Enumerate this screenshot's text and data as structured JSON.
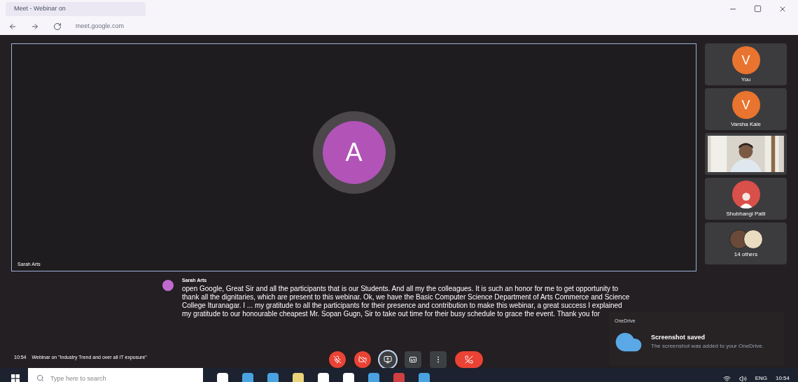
{
  "browser": {
    "tab_title": "Meet - Webinar on",
    "url": "meet.google.com"
  },
  "main_tile": {
    "avatar_letter": "A",
    "name": "Sarah Arts"
  },
  "participants": [
    {
      "kind": "avatar",
      "letter": "V",
      "color": "#e8742f",
      "name": "You"
    },
    {
      "kind": "avatar",
      "letter": "V",
      "color": "#e8742f",
      "name": "Varsha Kale"
    },
    {
      "kind": "video"
    },
    {
      "name": "Shubhangi Patil"
    },
    {
      "kind": "group",
      "name": "14 others"
    }
  ],
  "caption": {
    "speaker": "Sarah Arts",
    "text": "open Google, Great Sir and all the participants that is our Students. And all my the colleagues. It is such an honor for me to get opportunity to thank all the dignitaries, which are present to this webinar. Ok, we have the Basic Computer Science Department of Arts Commerce and Science College Ituranagar. I ... my gratitude to all the participants for their presence and contribution to make this webinar, a great success I explained my gratitude to our honourable cheapest Mr. Sopan Gugn, Sir to take out time for their busy schedule to grace the event. Thank you for"
  },
  "meeting": {
    "time": "10:54",
    "title": "Webinar on \"Industry Trend and over all IT exposure\""
  },
  "controls": [
    {
      "kind": "mic",
      "muted": true
    },
    {
      "kind": "camera",
      "muted": true
    },
    {
      "kind": "present"
    },
    {
      "kind": "captions"
    },
    {
      "kind": "more"
    },
    {
      "kind": "leave"
    }
  ],
  "notification": {
    "app": "OneDrive",
    "title": "Screenshot saved",
    "body": "The screenshot was added to your OneDrive."
  },
  "taskbar": {
    "search_placeholder": "Type here to search",
    "lang": "ENG",
    "time": "10:54"
  }
}
